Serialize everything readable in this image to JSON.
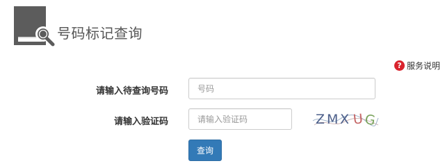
{
  "header": {
    "title": "号码标记查询",
    "logo_icon": "book-search-icon"
  },
  "help": {
    "icon": "question-circle-icon",
    "label": "服务说明",
    "icon_color": "#d9232d"
  },
  "form": {
    "phone": {
      "label": "请输入待查询号码",
      "placeholder": "号码",
      "value": ""
    },
    "captcha": {
      "label": "请输入验证码",
      "placeholder": "请输入验证码",
      "value": "",
      "image_text": "ZMX UG"
    },
    "submit_label": "查询"
  },
  "colors": {
    "primary_button": "#337ab7",
    "logo_gray": "#5c5c5c"
  }
}
